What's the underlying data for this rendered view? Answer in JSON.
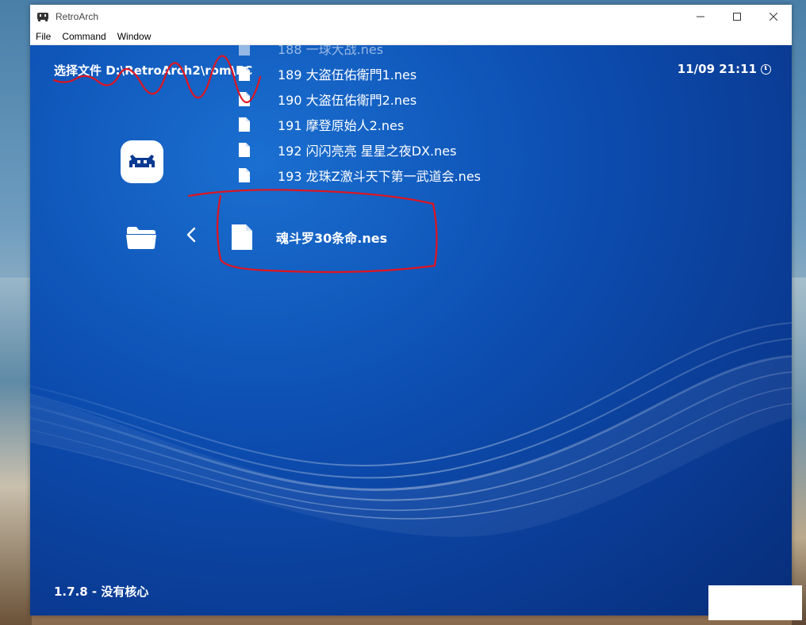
{
  "window": {
    "title": "RetroArch",
    "controls": [
      "minimize",
      "maximize",
      "close"
    ]
  },
  "menu": {
    "items": [
      "File",
      "Command",
      "Window"
    ]
  },
  "header": {
    "path_label": "选择文件 D:\\RetroArch2\\rom\\FC",
    "clock": "11/09 21:11",
    "clock_icon": "clock-icon"
  },
  "files": [
    {
      "label": "188 一球大战.nes",
      "state": "faded"
    },
    {
      "label": "189 大盗伍佑衛門1.nes"
    },
    {
      "label": "190 大盗伍佑衛門2.nes"
    },
    {
      "label": "191 摩登原始人2.nes"
    },
    {
      "label": "192 闪闪亮亮 星星之夜DX.nes"
    },
    {
      "label": "193 龙珠Z激斗天下第一武道会.nes"
    }
  ],
  "selected_file": {
    "label": "魂斗罗30条命.nes"
  },
  "footer": {
    "version": "1.7.8 - 没有核心"
  },
  "colors": {
    "annotation": "#e0141e",
    "background_top": "#1a6fd0",
    "background_bottom": "#072d78"
  }
}
